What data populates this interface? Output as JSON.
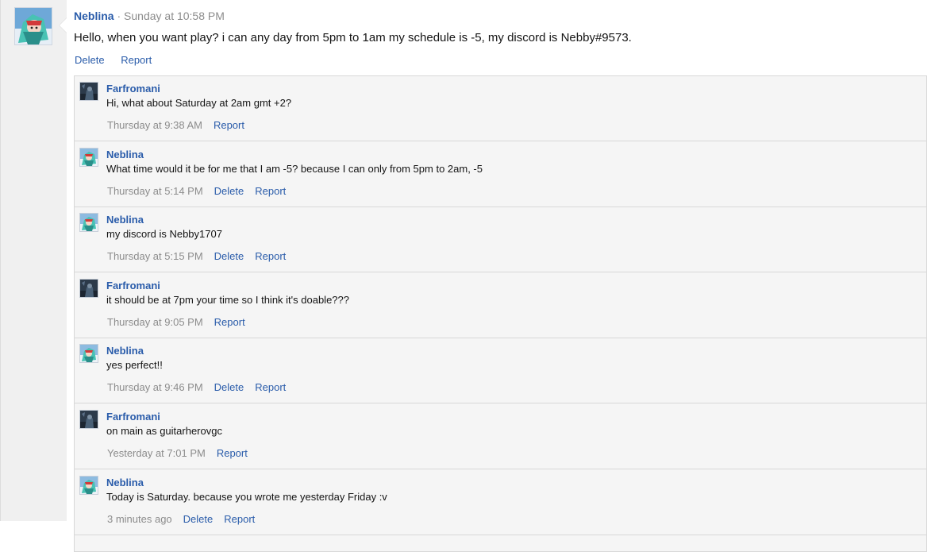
{
  "main_post": {
    "username": "Neblina",
    "separator": "·",
    "date": "Sunday at 10:58 PM",
    "message": "Hello, when you want play? i can any day from 5pm to 1am my schedule is -5, my discord is Nebby#9573.",
    "actions": {
      "delete": "Delete",
      "report": "Report"
    }
  },
  "comments": [
    {
      "username": "Farfromani",
      "avatar": "farfromani-avatar",
      "text": "Hi, what about Saturday at 2am gmt +2?",
      "date": "Thursday at 9:38 AM",
      "delete": null,
      "report": "Report"
    },
    {
      "username": "Neblina",
      "avatar": "neblina-avatar",
      "text": "What time would it be for me that I am -5? because I can only from 5pm to 2am, -5",
      "date": "Thursday at 5:14 PM",
      "delete": "Delete",
      "report": "Report"
    },
    {
      "username": "Neblina",
      "avatar": "neblina-avatar",
      "text": "my discord is Nebby1707",
      "date": "Thursday at 5:15 PM",
      "delete": "Delete",
      "report": "Report"
    },
    {
      "username": "Farfromani",
      "avatar": "farfromani-avatar",
      "text": "it should be at 7pm your time so I think it's doable???",
      "date": "Thursday at 9:05 PM",
      "delete": null,
      "report": "Report"
    },
    {
      "username": "Neblina",
      "avatar": "neblina-avatar",
      "text": "yes perfect!!",
      "date": "Thursday at 9:46 PM",
      "delete": "Delete",
      "report": "Report"
    },
    {
      "username": "Farfromani",
      "avatar": "farfromani-avatar",
      "text": "on main as guitarherovgc",
      "date": "Yesterday at 7:01 PM",
      "delete": null,
      "report": "Report"
    },
    {
      "username": "Neblina",
      "avatar": "neblina-avatar",
      "text": "Today is Saturday. because you wrote me yesterday Friday :v",
      "date": "3 minutes ago",
      "delete": "Delete",
      "report": "Report"
    }
  ],
  "colors": {
    "link": "#2a5caa",
    "muted": "#8c8c8c",
    "rail": "#f0f0f0",
    "comment_bg": "#f5f5f5"
  }
}
